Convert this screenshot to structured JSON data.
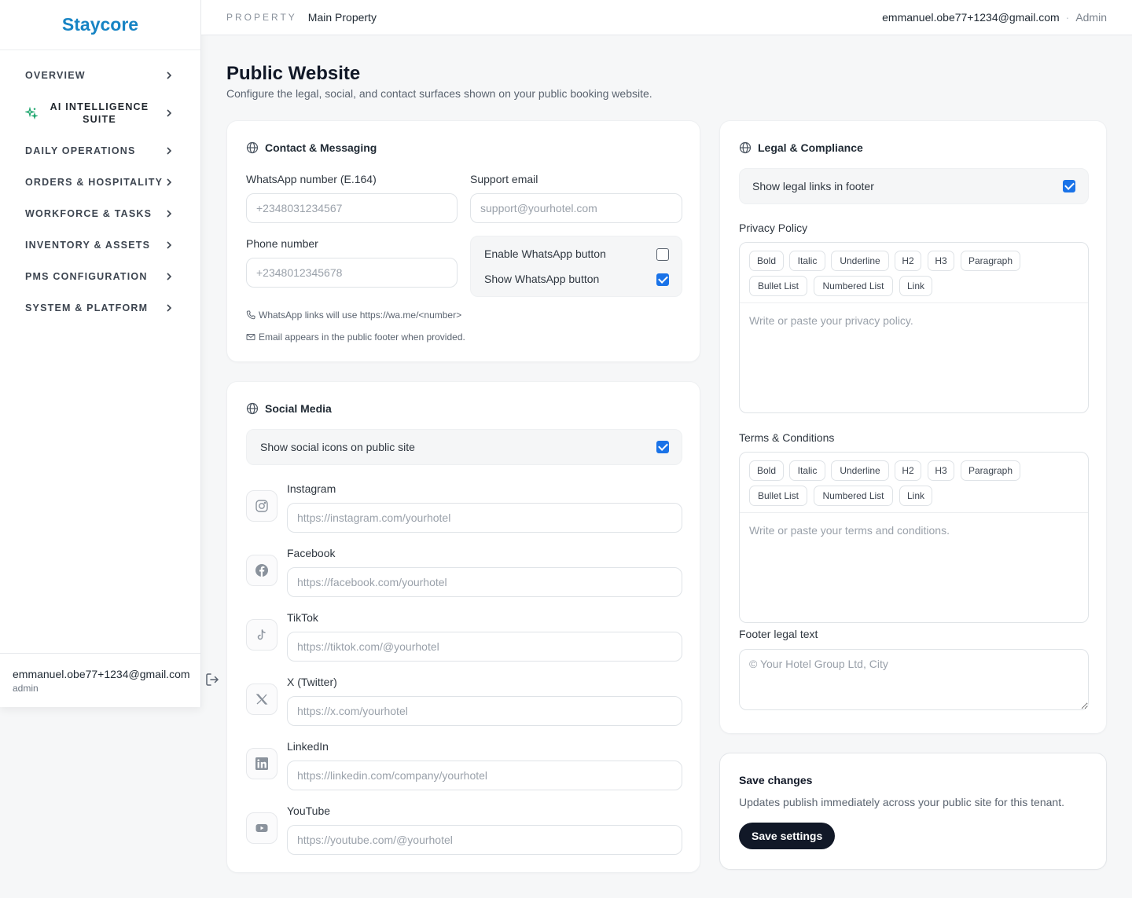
{
  "brand": "Staycore",
  "nav": [
    {
      "label": "OVERVIEW"
    },
    {
      "label": "AI INTELLIGENCE SUITE"
    },
    {
      "label": "DAILY OPERATIONS"
    },
    {
      "label": "ORDERS & HOSPITALITY"
    },
    {
      "label": "WORKFORCE & TASKS"
    },
    {
      "label": "INVENTORY & ASSETS"
    },
    {
      "label": "PMS CONFIGURATION"
    },
    {
      "label": "SYSTEM & PLATFORM"
    }
  ],
  "sidebar_user": {
    "email": "emmanuel.obe77+1234@gmail.com",
    "role": "admin"
  },
  "header": {
    "property_label": "PROPERTY",
    "property_name": "Main Property",
    "email": "emmanuel.obe77+1234@gmail.com",
    "separator": "·",
    "role": "Admin"
  },
  "page": {
    "title": "Public Website",
    "subtitle": "Configure the legal, social, and contact surfaces shown on your public booking website."
  },
  "contact": {
    "title": "Contact & Messaging",
    "whatsapp_label": "WhatsApp number (E.164)",
    "whatsapp_placeholder": "+2348031234567",
    "support_label": "Support email",
    "support_placeholder": "support@yourhotel.com",
    "phone_label": "Phone number",
    "phone_placeholder": "+2348012345678",
    "enable_whatsapp_label": "Enable WhatsApp button",
    "enable_whatsapp_checked": false,
    "show_whatsapp_label": "Show WhatsApp button",
    "show_whatsapp_checked": true,
    "hint_whatsapp": "WhatsApp links will use https://wa.me/<number>",
    "hint_email": "Email appears in the public footer when provided."
  },
  "social": {
    "title": "Social Media",
    "show_icons_label": "Show social icons on public site",
    "show_icons_checked": true,
    "items": [
      {
        "label": "Instagram",
        "placeholder": "https://instagram.com/yourhotel",
        "icon": "instagram-icon"
      },
      {
        "label": "Facebook",
        "placeholder": "https://facebook.com/yourhotel",
        "icon": "facebook-icon"
      },
      {
        "label": "TikTok",
        "placeholder": "https://tiktok.com/@yourhotel",
        "icon": "tiktok-icon"
      },
      {
        "label": "X (Twitter)",
        "placeholder": "https://x.com/yourhotel",
        "icon": "x-icon"
      },
      {
        "label": "LinkedIn",
        "placeholder": "https://linkedin.com/company/yourhotel",
        "icon": "linkedin-icon"
      },
      {
        "label": "YouTube",
        "placeholder": "https://youtube.com/@yourhotel",
        "icon": "youtube-icon"
      }
    ]
  },
  "legal": {
    "title": "Legal & Compliance",
    "show_links_label": "Show legal links in footer",
    "show_links_checked": true,
    "privacy_label": "Privacy Policy",
    "privacy_placeholder": "Write or paste your privacy policy.",
    "terms_label": "Terms & Conditions",
    "terms_placeholder": "Write or paste your terms and conditions.",
    "toolbar": [
      "Bold",
      "Italic",
      "Underline",
      "H2",
      "H3",
      "Paragraph",
      "Bullet List",
      "Numbered List",
      "Link"
    ],
    "footer_label": "Footer legal text",
    "footer_placeholder": "© Your Hotel Group Ltd, City"
  },
  "save": {
    "title": "Save changes",
    "subtitle": "Updates publish immediately across your public site for this tenant.",
    "button": "Save settings"
  },
  "colors": {
    "brand": "#1784c4",
    "accent": "#1a73e8",
    "ai_icon": "#1ea66e",
    "primary_button": "#111827"
  }
}
